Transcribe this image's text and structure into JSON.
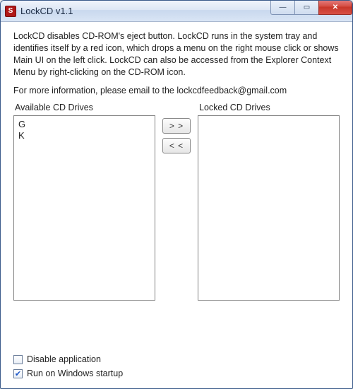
{
  "window": {
    "title": "LockCD v1.1",
    "app_icon_glyph": "S"
  },
  "description": "LockCD disables CD-ROM's eject button. LockCD runs in the system tray and identifies itself by a red icon, which drops a menu on the right mouse click or shows Main UI on the left click. LockCD can also be accessed from the Explorer Context Menu by right-clicking on the CD-ROM icon.",
  "info_line": "For more information, please email to the  lockcdfeedback@gmail.com",
  "panels": {
    "available_label": "Available CD Drives",
    "locked_label": "Locked CD Drives",
    "available_items": [
      "G",
      "K"
    ],
    "locked_items": []
  },
  "buttons": {
    "move_right": "> >",
    "move_left": "< <"
  },
  "checkboxes": {
    "disable_label": "Disable application",
    "disable_checked": false,
    "startup_label": "Run on Windows startup",
    "startup_checked": true
  },
  "win_controls": {
    "min_glyph": "—",
    "max_glyph": "▭",
    "close_glyph": "✕"
  }
}
